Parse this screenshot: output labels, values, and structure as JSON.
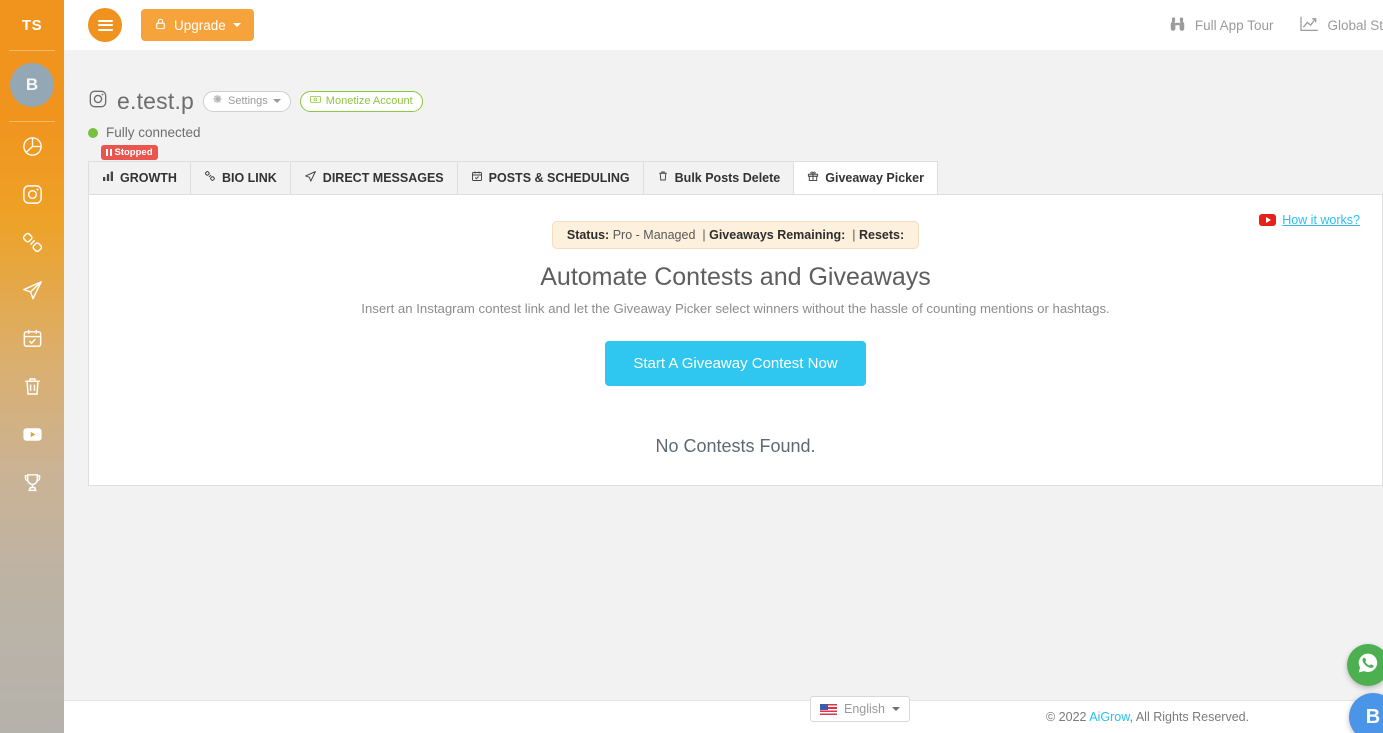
{
  "sidebar": {
    "brand_initials": "TS",
    "avatar_letter": "B",
    "items": [
      {
        "icon": "pie-chart-icon",
        "label": "Analytics"
      },
      {
        "icon": "instagram-icon",
        "label": "Instagram"
      },
      {
        "icon": "link-chain-icon",
        "label": "Bio Link"
      },
      {
        "icon": "paper-plane-icon",
        "label": "Direct Messages"
      },
      {
        "icon": "calendar-check-icon",
        "label": "Posts & Scheduling"
      },
      {
        "icon": "trash-icon",
        "label": "Bulk Posts Delete"
      },
      {
        "icon": "youtube-icon",
        "label": "YouTube"
      },
      {
        "icon": "trophy-icon",
        "label": "Giveaway Picker"
      }
    ]
  },
  "topbar": {
    "menu_icon": "hamburger-icon",
    "upgrade_label": "Upgrade",
    "upgrade_icon": "lock-icon",
    "links": [
      {
        "icon": "binoculars-icon",
        "label": "Full App Tour"
      },
      {
        "icon": "line-chart-icon",
        "label": "Global St"
      }
    ]
  },
  "account": {
    "platform_icon": "instagram-icon",
    "username": "e.test.p",
    "settings_label": "Settings",
    "settings_icon": "gear-icon",
    "monetize_label": "Monetize Account",
    "monetize_icon": "money-icon",
    "connection_status": "Fully connected",
    "status_color": "#76c043"
  },
  "tabs": [
    {
      "label": "GROWTH",
      "icon": "bar-chart-icon",
      "active": false,
      "badge": "Stopped",
      "badge_color": "#e8564f"
    },
    {
      "label": "BIO LINK",
      "icon": "link-chain-icon",
      "active": false
    },
    {
      "label": "DIRECT MESSAGES",
      "icon": "paper-plane-icon",
      "active": false
    },
    {
      "label": "POSTS & SCHEDULING",
      "icon": "calendar-check-icon",
      "active": false
    },
    {
      "label": "Bulk Posts Delete",
      "icon": "trash-icon",
      "active": false
    },
    {
      "label": "Giveaway Picker",
      "icon": "gift-icon",
      "active": true
    }
  ],
  "panel": {
    "how_it_works_label": "How it works?",
    "how_it_works_icon": "youtube-icon",
    "status_bar": {
      "status_key": "Status:",
      "status_value": "Pro - Managed",
      "separator_1": "|",
      "remaining_key": "Giveaways Remaining:",
      "remaining_value": "",
      "separator_2": "|",
      "resets_key": "Resets:",
      "resets_value": ""
    },
    "hero_title": "Automate Contests and Giveaways",
    "hero_subtitle": "Insert an Instagram contest link and let the Giveaway Picker select winners without the hassle of counting mentions or hashtags.",
    "cta_label": "Start A Giveaway Contest Now",
    "cta_color": "#2fc7ef",
    "empty_message": "No Contests Found."
  },
  "footer": {
    "language_label": "English",
    "language_flag": "us-flag-icon",
    "copyright_prefix": "© 2022",
    "brand_link": "AiGrow",
    "copyright_suffix": ", All Rights Reserved."
  },
  "floating": {
    "whatsapp_icon": "whatsapp-icon",
    "chat_label": "B"
  }
}
